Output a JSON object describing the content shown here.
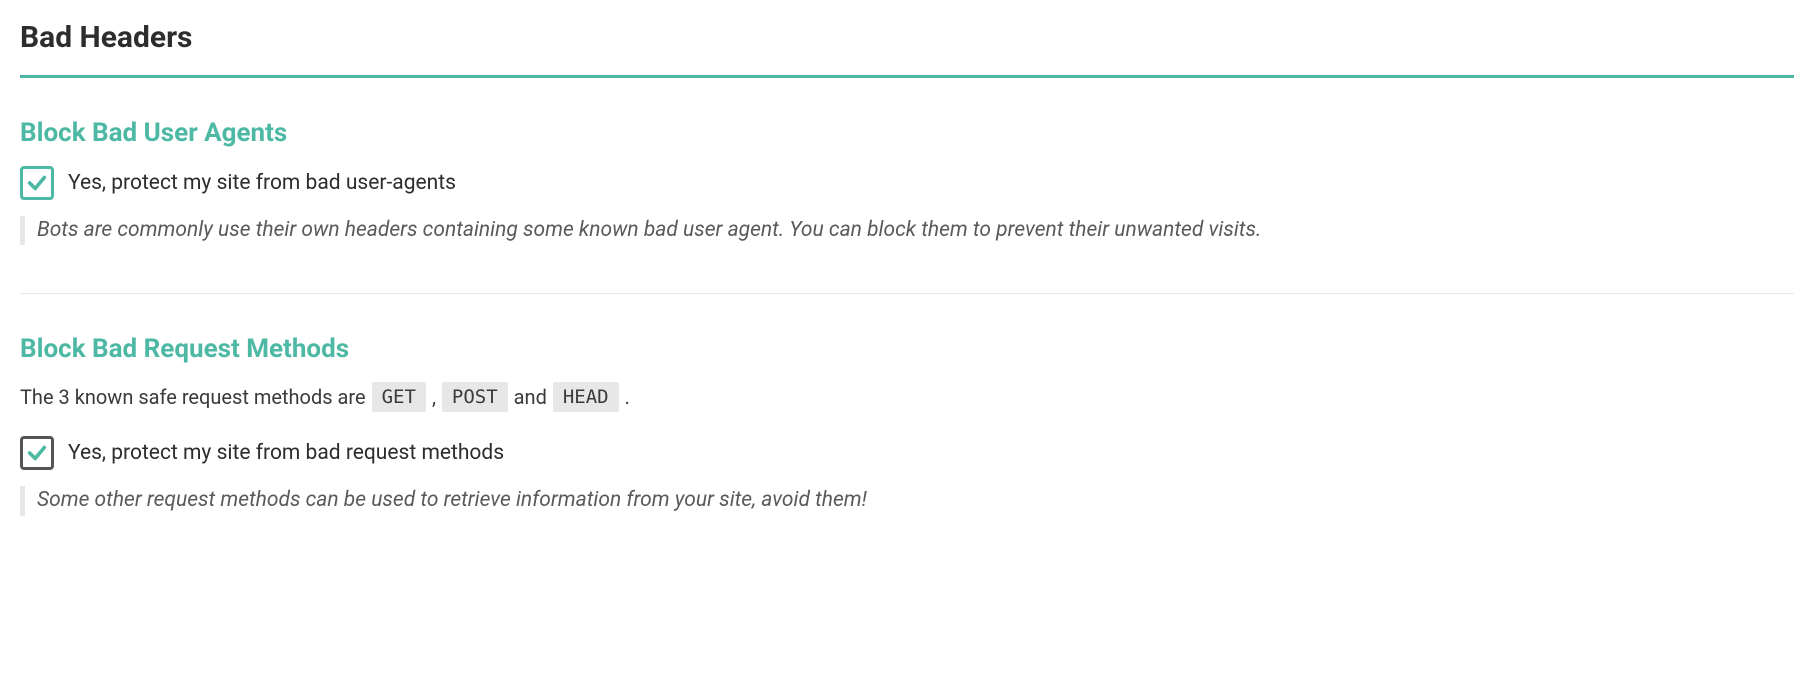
{
  "page": {
    "title": "Bad Headers"
  },
  "sections": {
    "userAgents": {
      "title": "Block Bad User Agents",
      "checkboxLabel": "Yes, protect my site from bad user-agents",
      "help": "Bots are commonly use their own headers containing some known bad user agent. You can block them to prevent their unwanted visits."
    },
    "requestMethods": {
      "title": "Block Bad Request Methods",
      "introPrefix": "The 3 known safe request methods are",
      "methods": [
        "GET",
        "POST",
        "HEAD"
      ],
      "introJoiner1": ",",
      "introJoiner2": "and",
      "introSuffix": ".",
      "checkboxLabel": "Yes, protect my site from bad request methods",
      "help": "Some other request methods can be used to retrieve information from your site, avoid them!"
    }
  }
}
